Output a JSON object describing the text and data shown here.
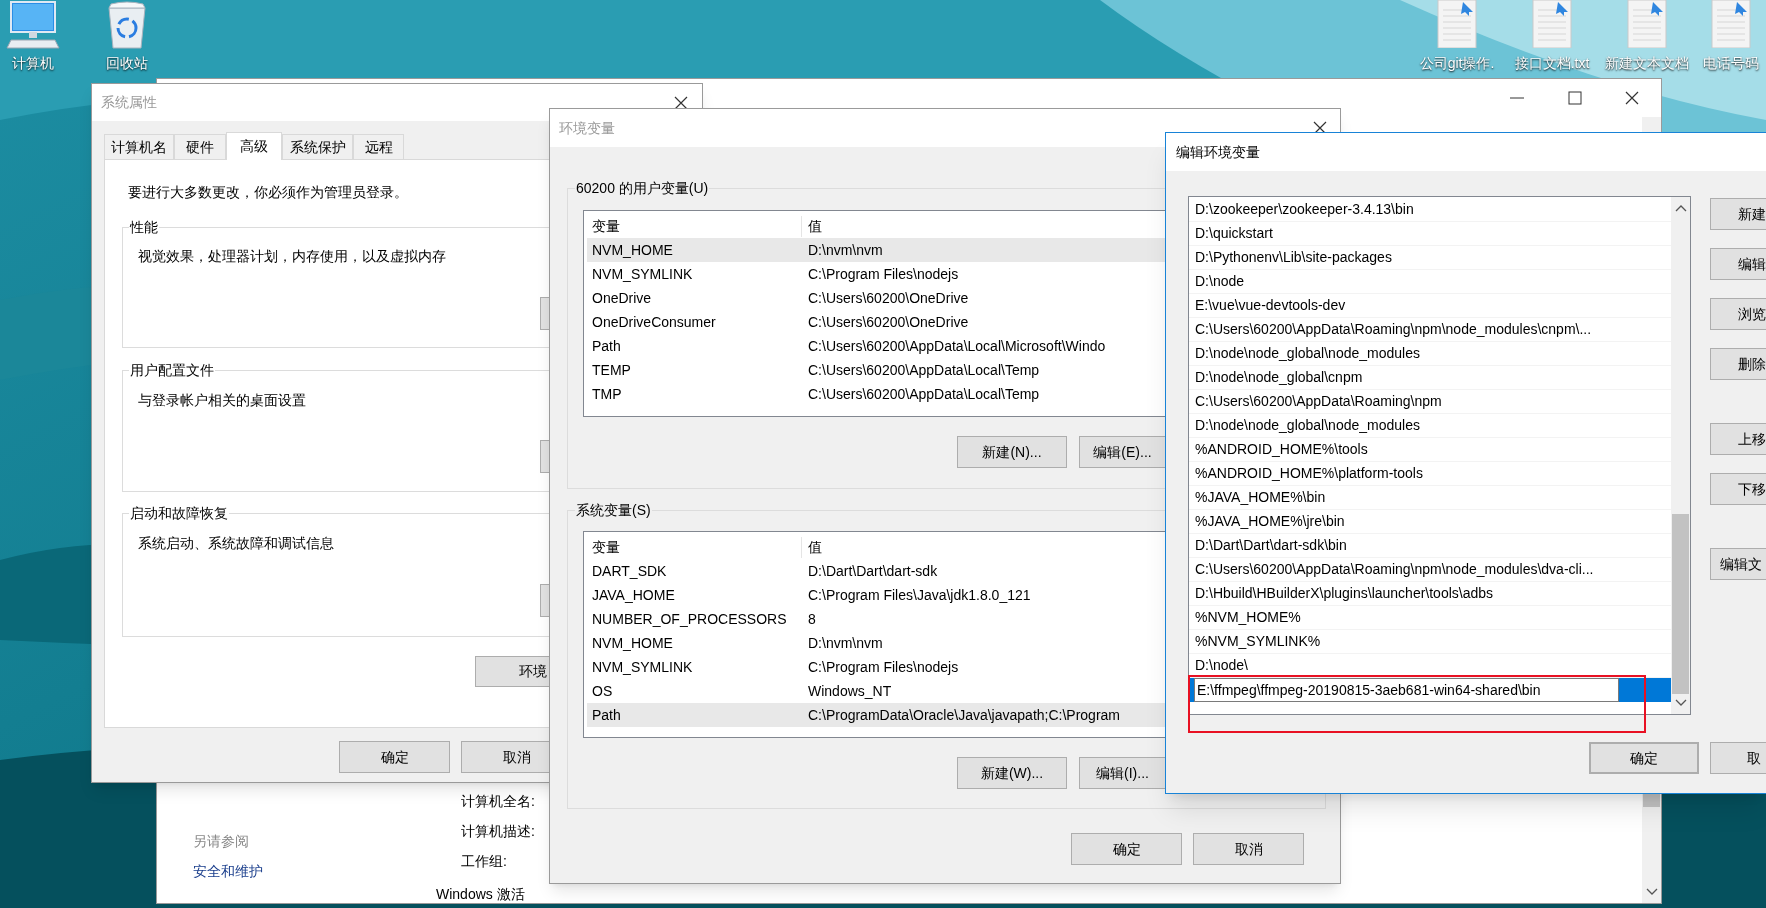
{
  "desktop_icons": [
    {
      "kind": "computer",
      "label": "计算机"
    },
    {
      "kind": "recycle_bin",
      "label": "回收站"
    }
  ],
  "desktop_files": [
    {
      "label": "公司git操作."
    },
    {
      "label": "接口文档.txt"
    },
    {
      "label": "新建文本文档"
    },
    {
      "label": "电话号码"
    }
  ],
  "system_window": {
    "see_also": "另请参阅",
    "links": [
      "安全和维护"
    ],
    "fields": [
      "计算机全名:",
      "计算机描述:",
      "工作组:"
    ],
    "activation": "Windows 激活"
  },
  "system_properties": {
    "title": "系统属性",
    "tabs": [
      {
        "label": "计算机名",
        "selected": false
      },
      {
        "label": "硬件",
        "selected": false
      },
      {
        "label": "高级",
        "selected": true
      },
      {
        "label": "系统保护",
        "selected": false
      },
      {
        "label": "远程",
        "selected": false
      }
    ],
    "notice": "要进行大多数更改，你必须作为管理员登录。",
    "groups": [
      {
        "title": "性能",
        "text": "视觉效果，处理器计划，内存使用，以及虚拟内存"
      },
      {
        "title": "用户配置文件",
        "text": "与登录帐户相关的桌面设置"
      },
      {
        "title": "启动和故障恢复",
        "text": "系统启动、系统故障和调试信息"
      }
    ],
    "env_button": "环境",
    "buttons": [
      "确定",
      "取消"
    ]
  },
  "environment_variables": {
    "title": "环境变量",
    "sections": [
      {
        "title": "60200 的用户变量(U)",
        "columns": [
          "变量",
          "值"
        ],
        "rows": [
          {
            "name": "NVM_HOME",
            "value": "D:\\nvm\\nvm",
            "selected": true
          },
          {
            "name": "NVM_SYMLINK",
            "value": "C:\\Program Files\\nodejs",
            "selected": false
          },
          {
            "name": "OneDrive",
            "value": "C:\\Users\\60200\\OneDrive",
            "selected": false
          },
          {
            "name": "OneDriveConsumer",
            "value": "C:\\Users\\60200\\OneDrive",
            "selected": false
          },
          {
            "name": "Path",
            "value": "C:\\Users\\60200\\AppData\\Local\\Microsoft\\Windo",
            "selected": false
          },
          {
            "name": "TEMP",
            "value": "C:\\Users\\60200\\AppData\\Local\\Temp",
            "selected": false
          },
          {
            "name": "TMP",
            "value": "C:\\Users\\60200\\AppData\\Local\\Temp",
            "selected": false
          }
        ],
        "buttons": [
          "新建(N)...",
          "编辑(E)..."
        ]
      },
      {
        "title": "系统变量(S)",
        "columns": [
          "变量",
          "值"
        ],
        "rows": [
          {
            "name": "DART_SDK",
            "value": "D:\\Dart\\Dart\\dart-sdk",
            "selected": false
          },
          {
            "name": "JAVA_HOME",
            "value": "C:\\Program Files\\Java\\jdk1.8.0_121",
            "selected": false
          },
          {
            "name": "NUMBER_OF_PROCESSORS",
            "value": "8",
            "selected": false
          },
          {
            "name": "NVM_HOME",
            "value": "D:\\nvm\\nvm",
            "selected": false
          },
          {
            "name": "NVM_SYMLINK",
            "value": "C:\\Program Files\\nodejs",
            "selected": false
          },
          {
            "name": "OS",
            "value": "Windows_NT",
            "selected": false
          },
          {
            "name": "Path",
            "value": "C:\\ProgramData\\Oracle\\Java\\javapath;C:\\Program",
            "selected": true
          }
        ],
        "buttons": [
          "新建(W)...",
          "编辑(I)..."
        ]
      }
    ],
    "buttons": [
      "确定",
      "取消"
    ]
  },
  "edit_variable": {
    "title": "编辑环境变量",
    "entries": [
      {
        "text": "D:\\zookeeper\\zookeeper-3.4.13\\bin",
        "editing": false
      },
      {
        "text": "D:\\quickstart",
        "editing": false
      },
      {
        "text": "D:\\Pythonenv\\Lib\\site-packages",
        "editing": false
      },
      {
        "text": "D:\\node",
        "editing": false
      },
      {
        "text": "E:\\vue\\vue-devtools-dev",
        "editing": false
      },
      {
        "text": "C:\\Users\\60200\\AppData\\Roaming\\npm\\node_modules\\cnpm\\...",
        "editing": false
      },
      {
        "text": "D:\\node\\node_global\\node_modules",
        "editing": false
      },
      {
        "text": "D:\\node\\node_global\\cnpm",
        "editing": false
      },
      {
        "text": "C:\\Users\\60200\\AppData\\Roaming\\npm",
        "editing": false
      },
      {
        "text": "D:\\node\\node_global\\node_modules",
        "editing": false
      },
      {
        "text": "%ANDROID_HOME%\\tools",
        "editing": false
      },
      {
        "text": "%ANDROID_HOME%\\platform-tools",
        "editing": false
      },
      {
        "text": "%JAVA_HOME%\\bin",
        "editing": false
      },
      {
        "text": "%JAVA_HOME%\\jre\\bin",
        "editing": false
      },
      {
        "text": "D:\\Dart\\Dart\\dart-sdk\\bin",
        "editing": false
      },
      {
        "text": "C:\\Users\\60200\\AppData\\Roaming\\npm\\node_modules\\dva-cli...",
        "editing": false
      },
      {
        "text": "D:\\Hbuild\\HBuilderX\\plugins\\launcher\\tools\\adbs",
        "editing": false
      },
      {
        "text": "%NVM_HOME%",
        "editing": false
      },
      {
        "text": "%NVM_SYMLINK%",
        "editing": false
      },
      {
        "text": "D:\\node\\",
        "editing": false
      },
      {
        "text": "E:\\ffmpeg\\ffmpeg-20190815-3aeb681-win64-shared\\bin",
        "editing": true
      }
    ],
    "side_buttons": [
      [
        "新建",
        "编辑",
        "浏览",
        "删除"
      ],
      [
        "上移",
        "下移"
      ],
      [
        "编辑文"
      ]
    ],
    "buttons": [
      {
        "label": "确定",
        "default": true
      },
      {
        "label": "取",
        "default": false
      }
    ]
  }
}
